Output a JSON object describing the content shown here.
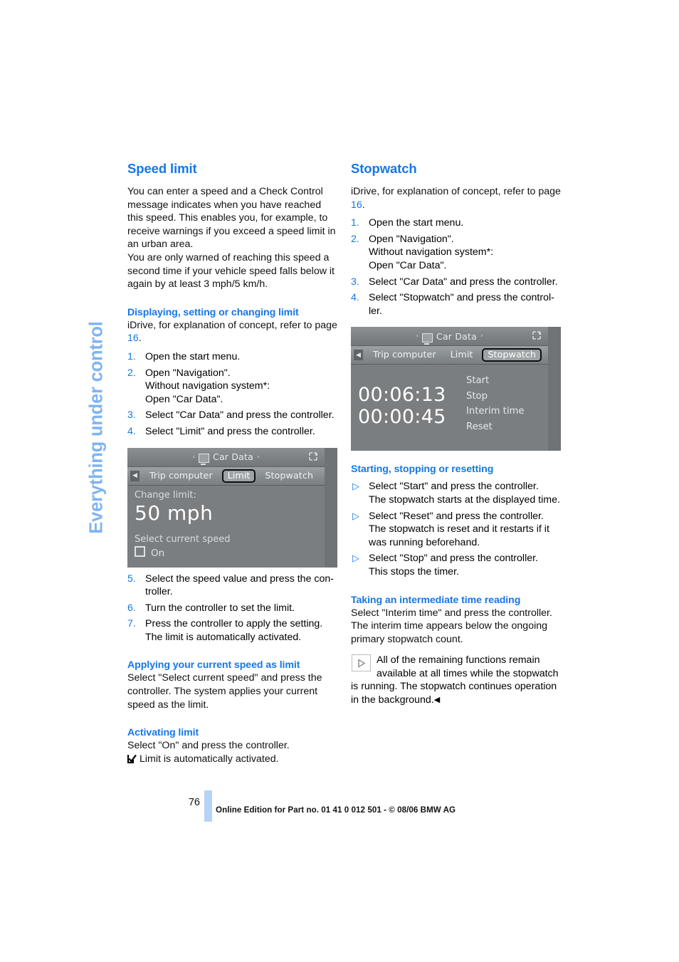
{
  "chapter_tab": {
    "label": "Everything under control"
  },
  "left_column": {
    "heading": "Speed limit",
    "intro_p1": "You can enter a speed and a Check Control message indicates when you have reached this speed. This enables you, for example, to receive warnings if you exceed a speed limit in an urban area.",
    "intro_p2": "You are only warned of reaching this speed a second time if your vehicle speed falls below it again by at least 3 mph/5 km/h.",
    "sub1": {
      "heading": "Displaying, setting or changing limit",
      "lead_before": "iDrive, for explanation of concept, refer to page ",
      "lead_page": "16",
      "lead_after": ".",
      "steps": [
        {
          "num": "1.",
          "lines": [
            "Open the start menu."
          ]
        },
        {
          "num": "2.",
          "lines": [
            "Open \"Navigation\".",
            "Without navigation system*:",
            "Open \"Car Data\"."
          ]
        },
        {
          "num": "3.",
          "lines": [
            "Select \"Car Data\" and press the controller."
          ]
        },
        {
          "num": "4.",
          "lines": [
            "Select \"Limit\" and press the controller."
          ]
        }
      ],
      "steps_after": [
        {
          "num": "5.",
          "lines": [
            "Select the speed value and press the con-",
            "troller."
          ]
        },
        {
          "num": "6.",
          "lines": [
            "Turn the controller to set the limit."
          ]
        },
        {
          "num": "7.",
          "lines": [
            "Press the controller to apply the setting.",
            "The limit is automatically activated."
          ]
        }
      ]
    },
    "sub2": {
      "heading": "Applying your current speed as limit",
      "body": "Select \"Select current speed\" and press the controller. The system applies your current speed as the limit."
    },
    "sub3": {
      "heading": "Activating limit",
      "body": "Select \"On\" and press the controller.",
      "checked_note": "Limit is automatically activated."
    }
  },
  "right_column": {
    "heading": "Stopwatch",
    "lead_before": "iDrive, for explanation of concept, refer to page ",
    "lead_page": "16",
    "lead_after": ".",
    "steps": [
      {
        "num": "1.",
        "lines": [
          "Open the start menu."
        ]
      },
      {
        "num": "2.",
        "lines": [
          "Open \"Navigation\".",
          "Without navigation system*:",
          "Open \"Car Data\"."
        ]
      },
      {
        "num": "3.",
        "lines": [
          "Select \"Car Data\" and press the controller."
        ]
      },
      {
        "num": "4.",
        "lines": [
          "Select \"Stopwatch\" and press the control-",
          "ler."
        ]
      }
    ],
    "sub1": {
      "heading": "Starting, stopping or resetting",
      "bullets": [
        [
          "Select \"Start\" and press the controller.",
          "The stopwatch starts at the displayed time."
        ],
        [
          "Select \"Reset\" and press the controller.",
          "The stopwatch is reset and it restarts if it",
          "was running beforehand."
        ],
        [
          "Select \"Stop\" and press the controller.",
          "This stops the timer."
        ]
      ]
    },
    "sub2": {
      "heading": "Taking an intermediate time reading",
      "body": "Select \"Interim time\" and press the controller. The interim time appears below the ongoing primary stopwatch count.",
      "note_first": "All of the remaining functions remain available at all times while the stopwatch",
      "note_rest": "is running. The stopwatch continues operation in the background.",
      "note_end_mark": "◀"
    }
  },
  "figure_limit": {
    "title": "Car Data",
    "title_arrow_left": "‹",
    "title_arrow_right": "›",
    "back_arrow": "◀",
    "tabs": [
      {
        "label": "Trip computer",
        "selected": false
      },
      {
        "label": "Limit",
        "selected": true
      },
      {
        "label": "Stopwatch",
        "selected": false
      }
    ],
    "change_label": "Change limit:",
    "value": "50 mph",
    "select_current": "Select current speed",
    "on_label": "On",
    "code": "·"
  },
  "figure_stopwatch": {
    "title": "Car Data",
    "title_arrow_left": "‹",
    "title_arrow_right": "›",
    "back_arrow": "◀",
    "tabs": [
      {
        "label": "Trip computer",
        "selected": false
      },
      {
        "label": "Limit",
        "selected": false
      },
      {
        "label": "Stopwatch",
        "selected": true
      }
    ],
    "time_main": "00:06:13",
    "time_interim": "00:00:45",
    "menu": [
      "Start",
      "Stop",
      "Interim time",
      "Reset"
    ],
    "code": "·"
  },
  "footer": {
    "page_number": "76",
    "imprint": "Online Edition for Part no. 01 41 0 012 501 - © 08/06 BMW AG"
  },
  "colors": {
    "accent_blue": "#1577e8",
    "tab_blue": "#7fb4f2",
    "footer_bar": "#b6d4f7",
    "screen_gray": "#7a7e81"
  }
}
